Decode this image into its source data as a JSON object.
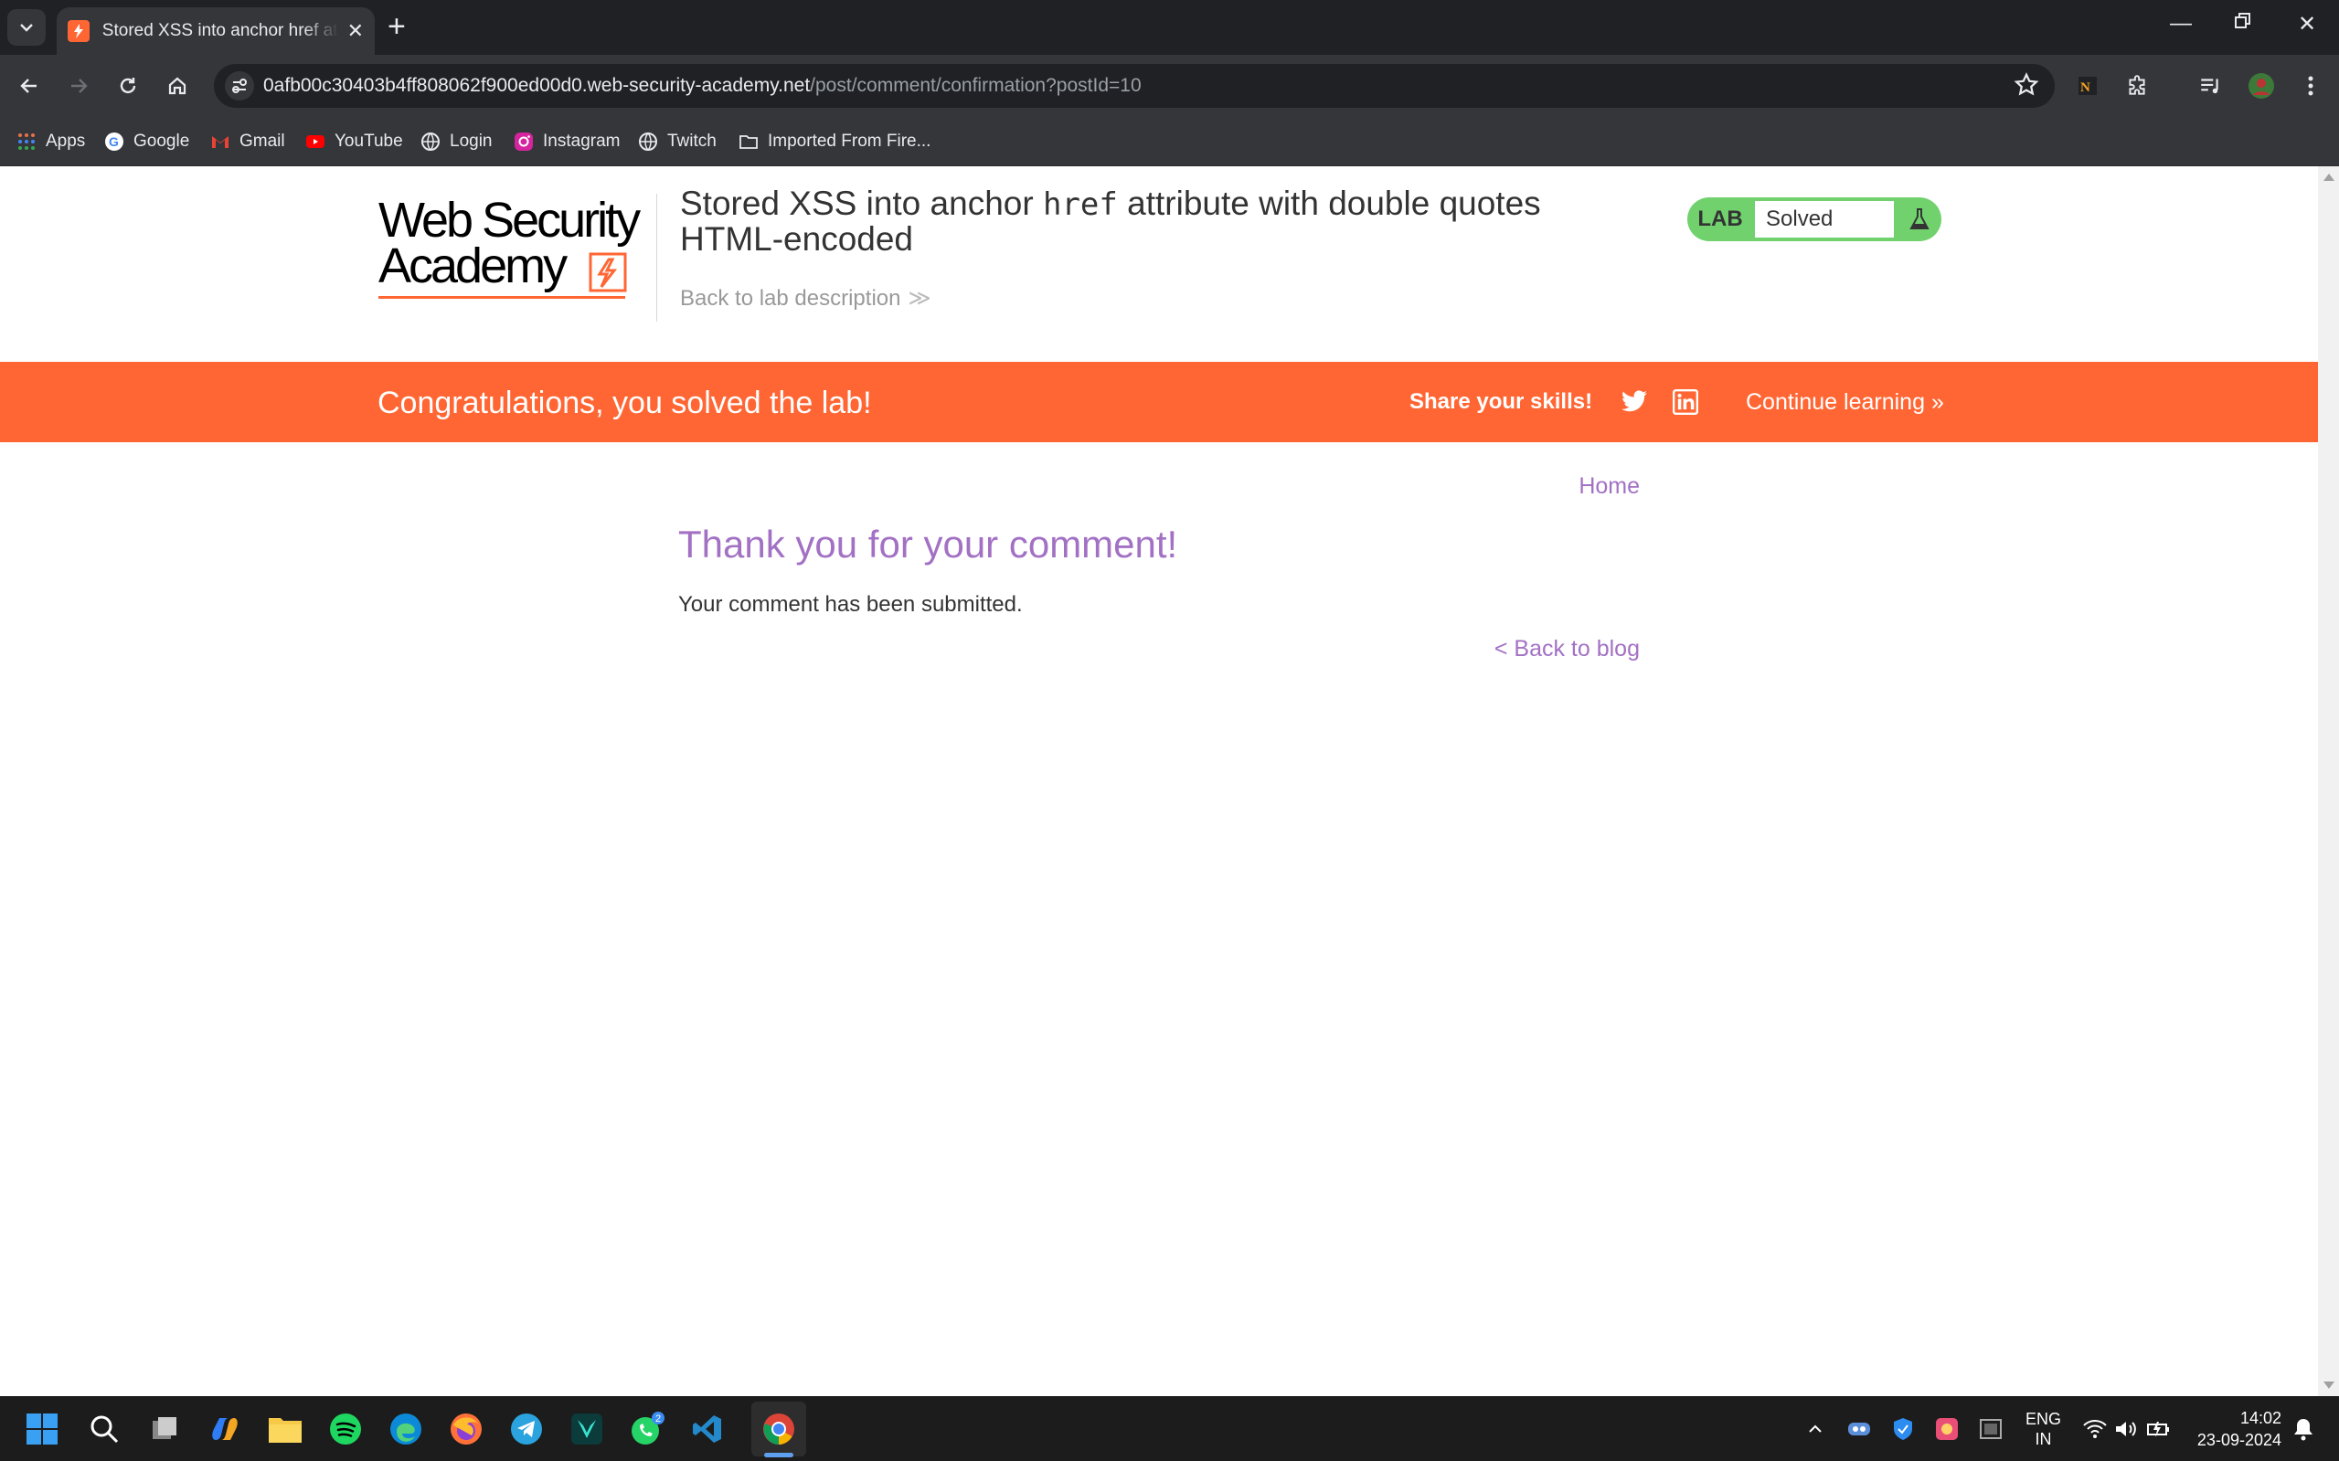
{
  "browser": {
    "tab_title": "Stored XSS into anchor href attribute with double quotes HTML-encoded",
    "url_host": "0afb00c30403b4ff808062f900ed00d0.web-security-academy.net",
    "url_path": "/post/comment/confirmation?postId=10",
    "bookmarks": [
      {
        "label": "Apps",
        "icon": "apps-grid-icon"
      },
      {
        "label": "Google",
        "icon": "google-icon"
      },
      {
        "label": "Gmail",
        "icon": "gmail-icon"
      },
      {
        "label": "YouTube",
        "icon": "youtube-icon"
      },
      {
        "label": "Login",
        "icon": "globe-icon"
      },
      {
        "label": "Instagram",
        "icon": "instagram-icon"
      },
      {
        "label": "Twitch",
        "icon": "globe-icon"
      },
      {
        "label": "Imported From Fire...",
        "icon": "folder-icon"
      }
    ]
  },
  "header": {
    "logo_line1": "Web Security",
    "logo_line2": "Academy",
    "lab_title_before": "Stored XSS into anchor ",
    "lab_title_code": "href",
    "lab_title_after": " attribute with double quotes HTML-encoded",
    "back_to_description": "Back to lab description",
    "lab_badge": "LAB",
    "lab_status": "Solved"
  },
  "banner": {
    "congratulations": "Congratulations, you solved the lab!",
    "share": "Share your skills!",
    "continue_learning": "Continue learning"
  },
  "content": {
    "home": "Home",
    "heading": "Thank you for your comment!",
    "message": "Your comment has been submitted.",
    "back_to_blog": "< Back to blog"
  },
  "taskbar": {
    "language_line1": "ENG",
    "language_line2": "IN",
    "time": "14:02",
    "date": "23-09-2024",
    "whatsapp_badge": "2"
  },
  "colors": {
    "accent_orange": "#ff6633",
    "link_purple": "#a371c4",
    "solved_green": "#70d16d"
  }
}
